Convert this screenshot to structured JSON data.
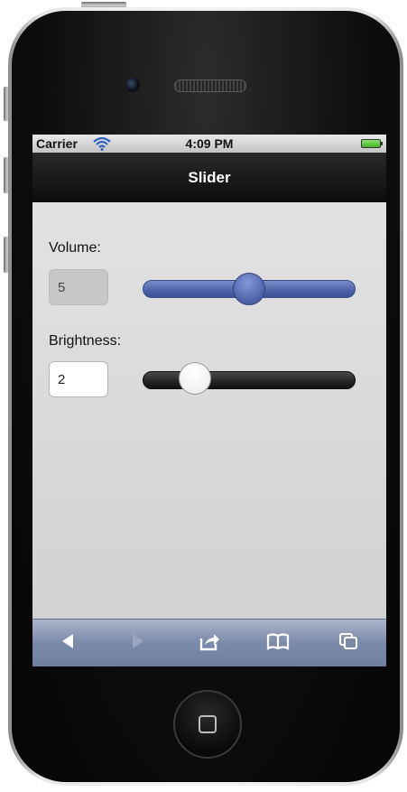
{
  "status_bar": {
    "carrier": "Carrier",
    "time": "4:09 PM"
  },
  "nav": {
    "title": "Slider"
  },
  "controls": {
    "volume": {
      "label": "Volume:",
      "value": "5",
      "slider_fraction": 0.5,
      "enabled": false
    },
    "brightness": {
      "label": "Brightness:",
      "value": "2",
      "slider_fraction": 0.2,
      "enabled": true
    }
  },
  "toolbar": {
    "items": [
      "back-arrow-icon",
      "forward-arrow-icon",
      "share-icon",
      "bookmarks-icon",
      "tabs-icon"
    ]
  },
  "colors": {
    "volume_track": "#4e62a8",
    "brightness_track": "#232323",
    "nav_bar": "#0c0c0c"
  }
}
